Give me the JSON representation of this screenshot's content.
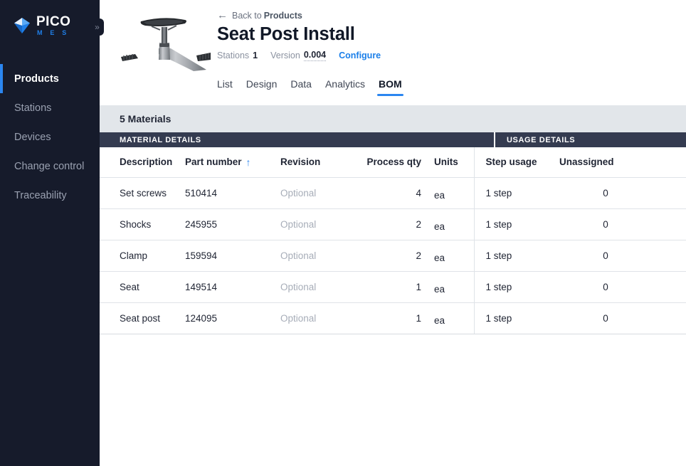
{
  "brand": {
    "name_primary": "PICO",
    "name_secondary": "M E S",
    "collapse_icon": "»"
  },
  "sidebar": {
    "items": [
      {
        "label": "Products",
        "active": true
      },
      {
        "label": "Stations",
        "active": false
      },
      {
        "label": "Devices",
        "active": false
      },
      {
        "label": "Change control",
        "active": false
      },
      {
        "label": "Traceability",
        "active": false
      }
    ]
  },
  "header": {
    "back_prefix": "Back to",
    "back_target": "Products",
    "back_arrow": "←",
    "title": "Seat Post Install",
    "meta": {
      "stations_label": "Stations",
      "stations_value": "1",
      "version_label": "Version",
      "version_value": "0.004",
      "configure_label": "Configure"
    }
  },
  "tabs": [
    {
      "label": "List",
      "active": false
    },
    {
      "label": "Design",
      "active": false
    },
    {
      "label": "Data",
      "active": false
    },
    {
      "label": "Analytics",
      "active": false
    },
    {
      "label": "BOM",
      "active": true
    }
  ],
  "materials": {
    "count_label": "5 Materials",
    "sections": {
      "material_details": "MATERIAL DETAILS",
      "usage_details": "USAGE DETAILS"
    },
    "columns": {
      "description": "Description",
      "part_number": "Part number",
      "sort_arrow": "↑",
      "revision": "Revision",
      "process_qty": "Process qty",
      "units": "Units",
      "step_usage": "Step usage",
      "unassigned": "Unassigned"
    },
    "rows": [
      {
        "description": "Set screws",
        "part_number": "510414",
        "revision": "Optional",
        "process_qty": "4",
        "units": "ea",
        "step_usage": "1 step",
        "unassigned": "0"
      },
      {
        "description": "Shocks",
        "part_number": "245955",
        "revision": "Optional",
        "process_qty": "2",
        "units": "ea",
        "step_usage": "1 step",
        "unassigned": "0"
      },
      {
        "description": "Clamp",
        "part_number": "159594",
        "revision": "Optional",
        "process_qty": "2",
        "units": "ea",
        "step_usage": "1 step",
        "unassigned": "0"
      },
      {
        "description": "Seat",
        "part_number": "149514",
        "revision": "Optional",
        "process_qty": "1",
        "units": "ea",
        "step_usage": "1 step",
        "unassigned": "0"
      },
      {
        "description": "Seat post",
        "part_number": "124095",
        "revision": "Optional",
        "process_qty": "1",
        "units": "ea",
        "step_usage": "1 step",
        "unassigned": "0"
      }
    ]
  },
  "colors": {
    "sidebar_bg": "#161b2b",
    "accent_blue": "#2b86f0",
    "section_header_bg": "#343b50",
    "count_bar_bg": "#e2e6ea"
  }
}
